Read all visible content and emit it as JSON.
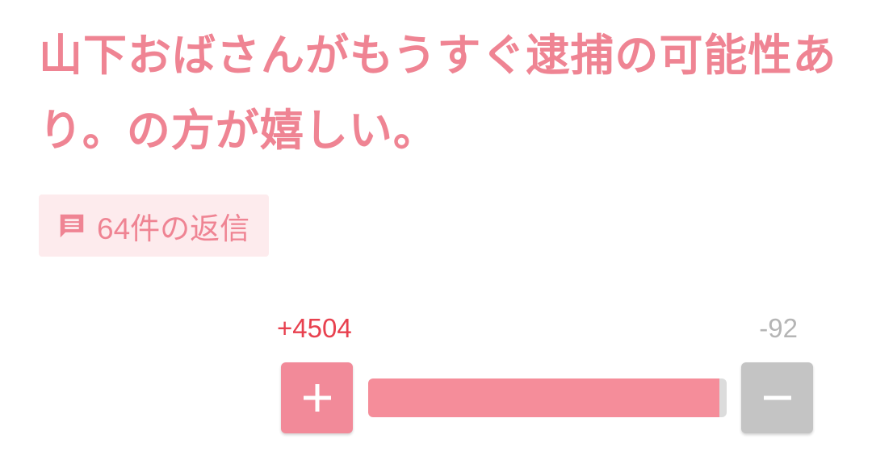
{
  "post": {
    "text": "山下おばさんがもうすぐ逮捕の可能性あり。の方が嬉しい。"
  },
  "replies": {
    "label": "64件の返信",
    "icon": "comment-icon"
  },
  "votes": {
    "plus_label": "+4504",
    "minus_label": "-92",
    "plus_count": 4504,
    "minus_count": 92,
    "plus_fraction": 0.98,
    "plus_button_icon": "plus-icon",
    "minus_button_icon": "minus-icon"
  },
  "colors": {
    "accent": "#ef8493",
    "plus_count": "#e8414f",
    "minus_count": "#b5b5b5",
    "reply_bg": "#fdebed",
    "bar_fill": "#f58d9a",
    "bar_track": "#dcdcdc",
    "minus_button": "#c4c4c4"
  }
}
